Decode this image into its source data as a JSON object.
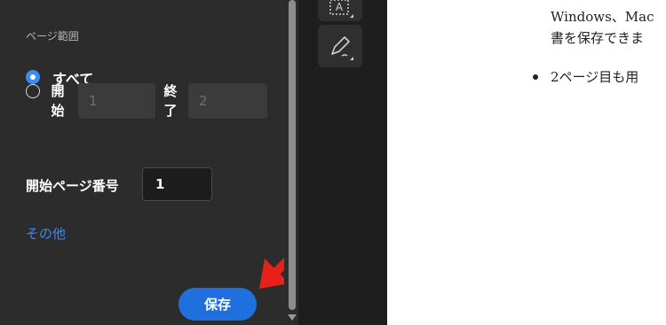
{
  "panel": {
    "section_label": "ページ範囲",
    "radio_all_label": "すべて",
    "radio_range_label_1": "開",
    "radio_range_label_2": "始",
    "range_end_label_1": "終",
    "range_end_label_2": "了",
    "range_start_value": "1",
    "range_end_value": "2",
    "start_page_label": "開始ページ番号",
    "start_page_value": "1",
    "more_link": "その他",
    "save_label": "保存"
  },
  "toolbar": {
    "top_icon": "text-box-icon",
    "edit_icon": "pen-edit-icon"
  },
  "document": {
    "line1": "Windows、Mac",
    "line2": "書を保存できま",
    "bullet_text": "2ページ目も用"
  },
  "colors": {
    "panel_bg": "#2c2c2c",
    "accent": "#3b8af5",
    "save_button": "#1f6fde",
    "annotation_arrow": "#e8201a"
  }
}
